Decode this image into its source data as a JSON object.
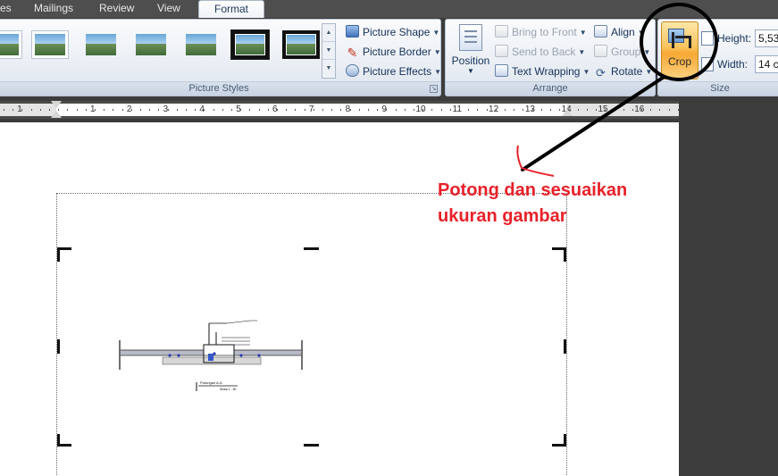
{
  "tabs": [
    {
      "label": "es",
      "active": false
    },
    {
      "label": "Mailings",
      "active": false
    },
    {
      "label": "Review",
      "active": false
    },
    {
      "label": "View",
      "active": false
    },
    {
      "label": "Format",
      "active": true
    }
  ],
  "picture_styles": {
    "label": "Picture Styles",
    "thumbnails": [
      "simple-frame-white",
      "simple-frame-gray",
      "soft-edge",
      "reflected",
      "soft-shadow",
      "thick-black-frame",
      "black-frame"
    ],
    "selected_index": 5,
    "commands": {
      "shape": "Picture Shape",
      "border": "Picture Border",
      "effects": "Picture Effects"
    }
  },
  "arrange": {
    "label": "Arrange",
    "position": "Position",
    "bring_to_front": "Bring to Front",
    "send_to_back": "Send to Back",
    "text_wrapping": "Text Wrapping",
    "align": "Align",
    "group": "Group",
    "rotate": "Rotate"
  },
  "size": {
    "label": "Size",
    "crop": "Crop",
    "height_label": "Height:",
    "height_value": "5,53",
    "width_label": "Width:",
    "width_value": "14 c"
  },
  "ruler": {
    "numbers": [
      "1",
      "1",
      "2",
      "3",
      "4",
      "5",
      "6",
      "7",
      "8",
      "9",
      "10",
      "11",
      "12",
      "13",
      "14",
      "15",
      "16"
    ]
  },
  "annotation": {
    "line1": "Potong dan sesuaikan",
    "line2": "ukuran gambar",
    "color": "#e8212a"
  },
  "drawing_labels": {
    "caption": "Potongan A-A",
    "scale": "Skala 1 : 50"
  }
}
